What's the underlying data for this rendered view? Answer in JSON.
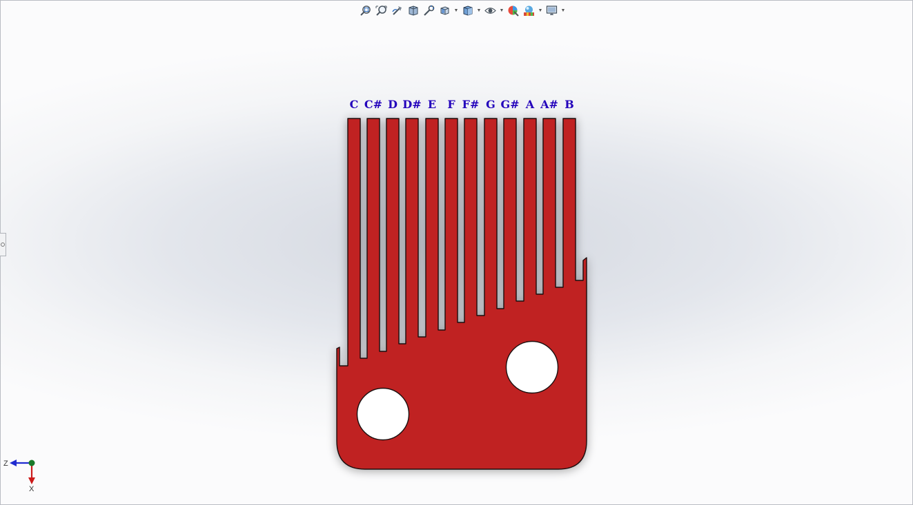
{
  "toolbar": {
    "items": [
      {
        "name": "zoom-to-fit-icon",
        "has_menu": false
      },
      {
        "name": "zoom-to-area-icon",
        "has_menu": false
      },
      {
        "name": "previous-view-icon",
        "has_menu": false
      },
      {
        "name": "section-view-icon",
        "has_menu": false
      },
      {
        "name": "dynamic-annotation-icon",
        "has_menu": false
      },
      {
        "name": "view-orientation-icon",
        "has_menu": true
      },
      {
        "name": "display-style-icon",
        "has_menu": true
      },
      {
        "name": "hide-show-items-icon",
        "has_menu": true
      },
      {
        "name": "edit-appearance-icon",
        "has_menu": false
      },
      {
        "name": "apply-scene-icon",
        "has_menu": true
      },
      {
        "name": "view-settings-icon",
        "has_menu": true
      }
    ]
  },
  "model": {
    "body_color": "#c02020",
    "outline_color": "#1a0f0f",
    "tine_labels": [
      "C",
      "C#",
      "D",
      "D#",
      "E",
      "F",
      "F#",
      "G",
      "G#",
      "A",
      "A#",
      "B"
    ],
    "label_color": "#2200bb"
  },
  "triad": {
    "axis_horizontal": "Z",
    "axis_vertical": "X",
    "z_color": "#1f2bd0",
    "x_color": "#cc1a1a",
    "origin_color": "#1a7a2a"
  }
}
